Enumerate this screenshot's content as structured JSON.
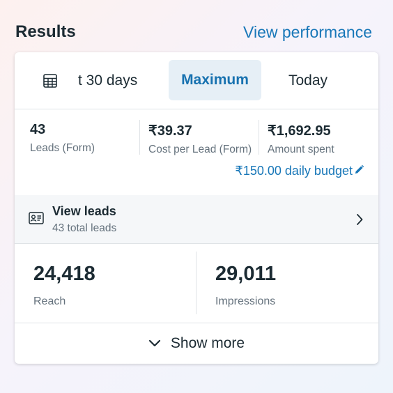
{
  "header": {
    "title": "Results",
    "view_performance": "View performance"
  },
  "tabs": {
    "range_label": "t 30 days",
    "maximum_label": "Maximum",
    "today_label": "Today",
    "calendar_icon": "calendar-icon",
    "selected": "Maximum"
  },
  "stats": [
    {
      "value": "43",
      "label": "Leads (Form)"
    },
    {
      "value": "₹39.37",
      "label": "Cost per Lead (Form)"
    },
    {
      "value": "₹1,692.95",
      "label": "Amount spent"
    }
  ],
  "budget": {
    "text": "₹150.00 daily budget",
    "icon": "pencil-icon"
  },
  "leads": {
    "title": "View leads",
    "subtitle": "43 total leads",
    "icon": "contact-card-icon"
  },
  "metrics": [
    {
      "value": "24,418",
      "label": "Reach"
    },
    {
      "value": "29,011",
      "label": "Impressions"
    }
  ],
  "show_more": {
    "label": "Show more",
    "icon": "chevron-down-icon"
  },
  "colors": {
    "accent": "#1877b8",
    "selected_tab_bg": "#e6eff6",
    "text_primary": "#1c2b33",
    "text_secondary": "#65727d"
  }
}
